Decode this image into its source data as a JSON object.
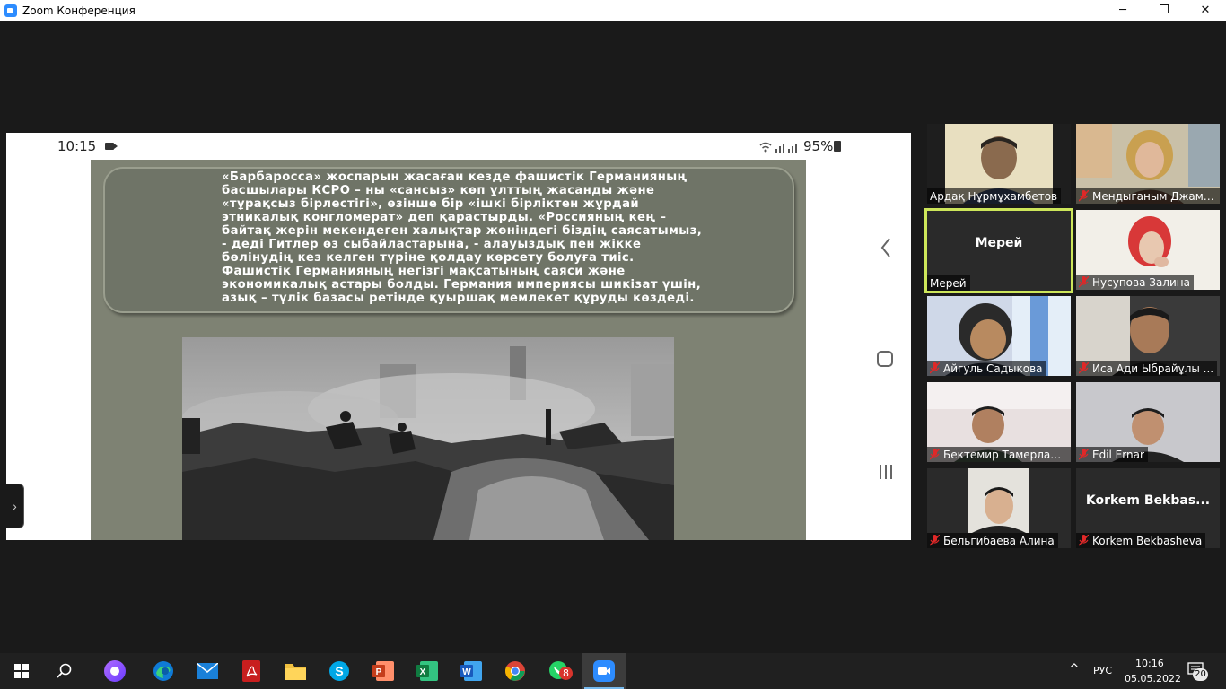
{
  "window": {
    "title": "Zoom Конференция",
    "minimize_glyph": "─",
    "restore_glyph": "❐",
    "close_glyph": "✕"
  },
  "share": {
    "phone_time": "10:15",
    "phone_battery": "95%",
    "slide_text": "«Барбаросса» жоспарын жасаған кезде фашистік Германияның\nбасшылары КСРО – ны «сансыз» көп ұлттың жасанды және\n«тұрақсыз бірлестігі», өзінше бір «ішкі бірліктен жұрдай\nэтникалық конгломерат» деп қарастырды. «Россияның кең –\nбайтақ жерін мекендеген халықтар жөніндегі біздің саясатымыз,\n- деді Гитлер өз сыбайластарына, - алауыздық пен жікке\nбөлінудің кез келген түріне қолдау көрсету болуға тиіс.\nФашистік Германияның негізгі мақсатының саяси және\nэкономикалық астары болды. Германия империясы шикізат үшін,\nазық – түлік базасы ретінде қуыршақ мемлекет құруды көздеді.",
    "side_arrow": "›"
  },
  "participants": [
    {
      "name": "Ардақ Нұрмұхамбетов",
      "muted": false,
      "video": true
    },
    {
      "name": "Мендыганым Джамал...",
      "muted": true,
      "video": true
    },
    {
      "name": "Мерей",
      "muted": false,
      "video": false,
      "big_name": "Мерей",
      "active": true
    },
    {
      "name": "Нусупова Залина",
      "muted": true,
      "video": true
    },
    {
      "name": "Айгуль Садыкова",
      "muted": true,
      "video": true
    },
    {
      "name": "Иса Ади Ыбрайұлы ...",
      "muted": true,
      "video": true
    },
    {
      "name": "Бектемир Тамерлан ...",
      "muted": true,
      "video": true
    },
    {
      "name": "Edil Ernar",
      "muted": true,
      "video": true
    },
    {
      "name": "Бельгибаева Алина",
      "muted": true,
      "video": true
    },
    {
      "name": "Korkem Bekbasheva",
      "muted": true,
      "video": false,
      "big_name": "Korkem  Bekbas..."
    }
  ],
  "taskbar": {
    "icons": [
      "windows-start-icon",
      "search-icon",
      "alice-icon",
      "edge-icon",
      "mail-icon",
      "pdf-icon",
      "folder-icon",
      "skype-icon",
      "powerpoint-icon",
      "excel-icon",
      "word-icon",
      "chrome-icon",
      "whatsapp-icon",
      "zoom-icon"
    ],
    "whatsapp_badge": "8",
    "lang": "РУС",
    "time": "10:16",
    "date": "05.05.2022",
    "notif_count": "20",
    "chevron": "^"
  }
}
